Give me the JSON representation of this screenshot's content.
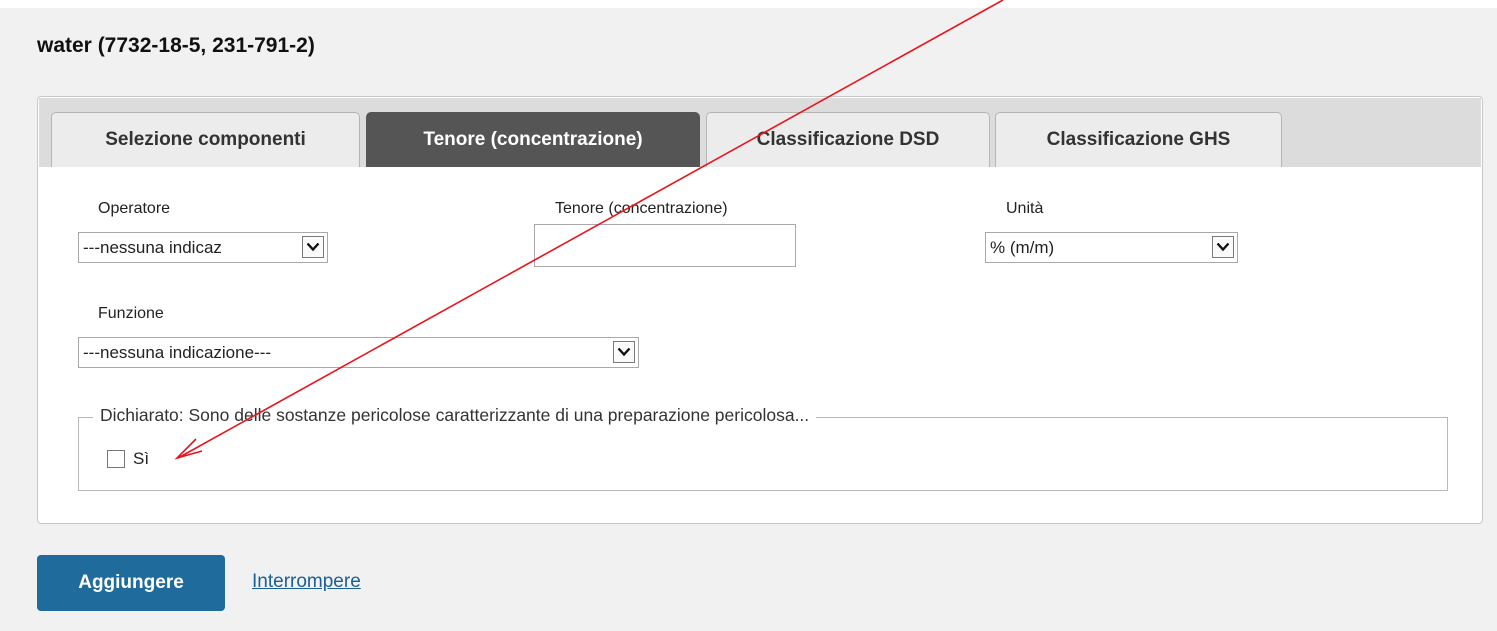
{
  "header": {
    "title": "water (7732-18-5, 231-791-2)"
  },
  "tabs": [
    {
      "label": "Selezione componenti",
      "active": false
    },
    {
      "label": "Tenore (concentrazione)",
      "active": true
    },
    {
      "label": "Classificazione DSD",
      "active": false
    },
    {
      "label": "Classificazione GHS",
      "active": false
    }
  ],
  "form": {
    "operator": {
      "label": "Operatore",
      "value": "---nessuna indicaz"
    },
    "content": {
      "label": "Tenore (concentrazione)",
      "value": ""
    },
    "unit": {
      "label": "Unità",
      "value": "% (m/m)"
    },
    "function": {
      "label": "Funzione",
      "value": "---nessuna indicazione---"
    },
    "declared": {
      "legend": "Dichiarato: Sono delle sostanze pericolose caratterizzante di una preparazione pericolosa...",
      "checkbox_label": "Sì",
      "checked": false
    }
  },
  "actions": {
    "add_label": "Aggiungere",
    "cancel_label": "Interrompere"
  },
  "colors": {
    "active_tab": "#555555",
    "primary_button": "#1f6b9c",
    "link": "#1a5f95",
    "annotation_arrow": "#e8141b"
  },
  "icons": [
    "chevron-down-icon",
    "red-annotation-arrow"
  ]
}
